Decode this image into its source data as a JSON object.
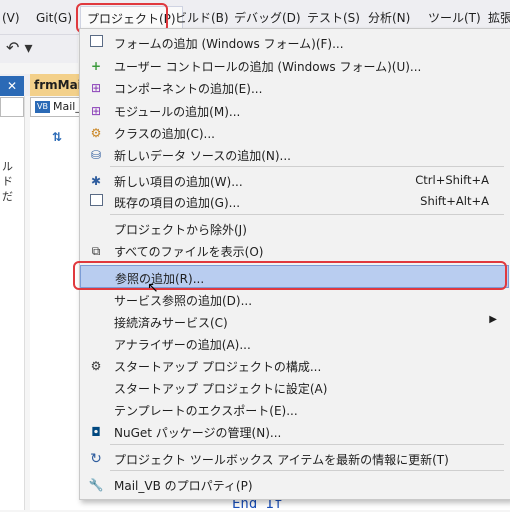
{
  "menubar": {
    "items": [
      {
        "label": "(V)"
      },
      {
        "label": "Git(G)"
      },
      {
        "label": "プロジェクト(P)"
      },
      {
        "label": "ビルド(B)"
      },
      {
        "label": "デバッグ(D)"
      },
      {
        "label": "テスト(S)"
      },
      {
        "label": "分析(N)"
      },
      {
        "label": "ツール(T)"
      },
      {
        "label": "拡張"
      }
    ]
  },
  "editor": {
    "tab_label": "frmMain",
    "vb_badge": "VB",
    "vb_dropdown": "Mail_",
    "left_pane_text": [
      "ル",
      "ド",
      "だ"
    ],
    "code_line": "End If"
  },
  "menu": {
    "items": [
      {
        "label": "フォームの追加 (Windows フォーム)(F)...",
        "icon": "add-form-icon"
      },
      {
        "label": "ユーザー コントロールの追加 (Windows フォーム)(U)...",
        "icon": "add-user-control-icon"
      },
      {
        "label": "コンポーネントの追加(E)...",
        "icon": "add-component-icon"
      },
      {
        "label": "モジュールの追加(M)...",
        "icon": "add-module-icon"
      },
      {
        "label": "クラスの追加(C)...",
        "icon": "add-class-icon"
      },
      {
        "label": "新しいデータ ソースの追加(N)...",
        "icon": "add-data-source-icon"
      },
      {
        "label": "新しい項目の追加(W)...",
        "shortcut": "Ctrl+Shift+A",
        "icon": "new-item-icon"
      },
      {
        "label": "既存の項目の追加(G)...",
        "shortcut": "Shift+Alt+A",
        "icon": "existing-item-icon"
      },
      {
        "label": "プロジェクトから除外(J)"
      },
      {
        "label": "すべてのファイルを表示(O)",
        "icon": "show-all-files-icon"
      },
      {
        "label": "参照の追加(R)..."
      },
      {
        "label": "サービス参照の追加(D)..."
      },
      {
        "label": "接続済みサービス(C)"
      },
      {
        "label": "アナライザーの追加(A)..."
      },
      {
        "label": "スタートアップ プロジェクトの構成...",
        "icon": "gear-icon"
      },
      {
        "label": "スタートアップ プロジェクトに設定(A)"
      },
      {
        "label": "テンプレートのエクスポート(E)..."
      },
      {
        "label": "NuGet パッケージの管理(N)...",
        "icon": "nuget-icon"
      },
      {
        "label": "プロジェクト ツールボックス アイテムを最新の情報に更新(T)",
        "icon": "refresh-icon"
      },
      {
        "label": "Mail_VB のプロパティ(P)",
        "icon": "wrench-icon"
      }
    ]
  },
  "colors": {
    "highlight_ring": "#e0393e",
    "menu_hover": "#b9cdf0",
    "accent_blue": "#2b6ab6"
  }
}
